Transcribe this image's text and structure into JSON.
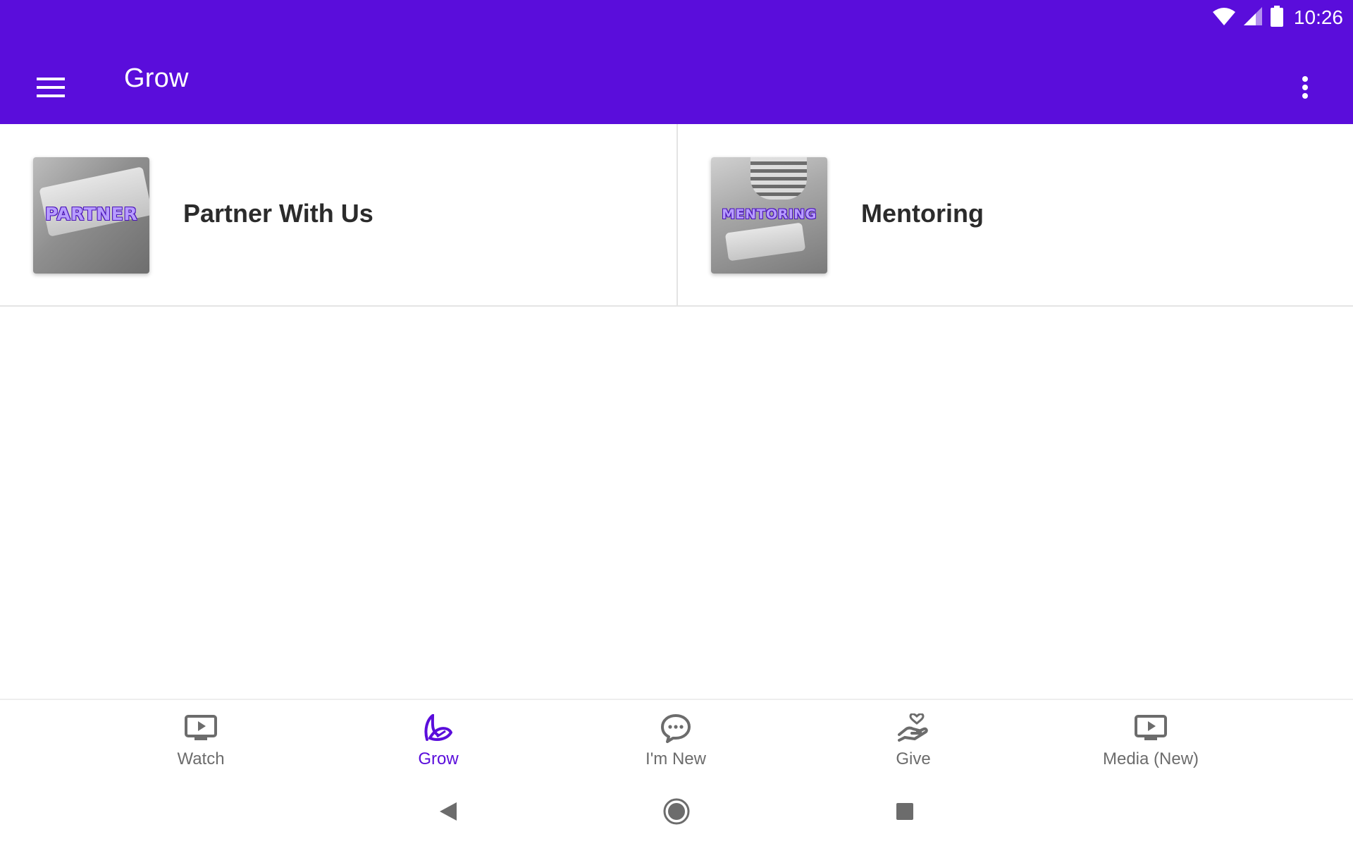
{
  "status_bar": {
    "time": "10:26",
    "icons": [
      "wifi-icon",
      "cell-signal-icon",
      "battery-icon"
    ]
  },
  "toolbar": {
    "title": "Grow",
    "menu_icon": "hamburger-menu-icon",
    "overflow_icon": "more-vert-icon"
  },
  "cards": [
    {
      "title": "Partner With Us",
      "thumbnail_text": "PARTNER",
      "thumbnail_icon": "open-bible-image"
    },
    {
      "title": "Mentoring",
      "thumbnail_text": "MENTORING",
      "thumbnail_icon": "mentoring-image"
    }
  ],
  "bottom_nav": {
    "items": [
      {
        "label": "Watch",
        "icon": "tv-play-icon",
        "active": false
      },
      {
        "label": "Grow",
        "icon": "sprout-icon",
        "active": true
      },
      {
        "label": "I'm New",
        "icon": "chat-bubble-icon",
        "active": false
      },
      {
        "label": "Give",
        "icon": "hand-heart-icon",
        "active": false
      },
      {
        "label": "Media (New)",
        "icon": "tv-play-icon",
        "active": false
      }
    ]
  },
  "system_nav": {
    "icons": [
      "back-icon",
      "home-icon",
      "recents-icon"
    ]
  },
  "colors": {
    "primary": "#5a0ddb",
    "inactive_nav": "#6c6c6c",
    "card_title": "#2b2b2b",
    "divider": "#e4e4e4"
  }
}
